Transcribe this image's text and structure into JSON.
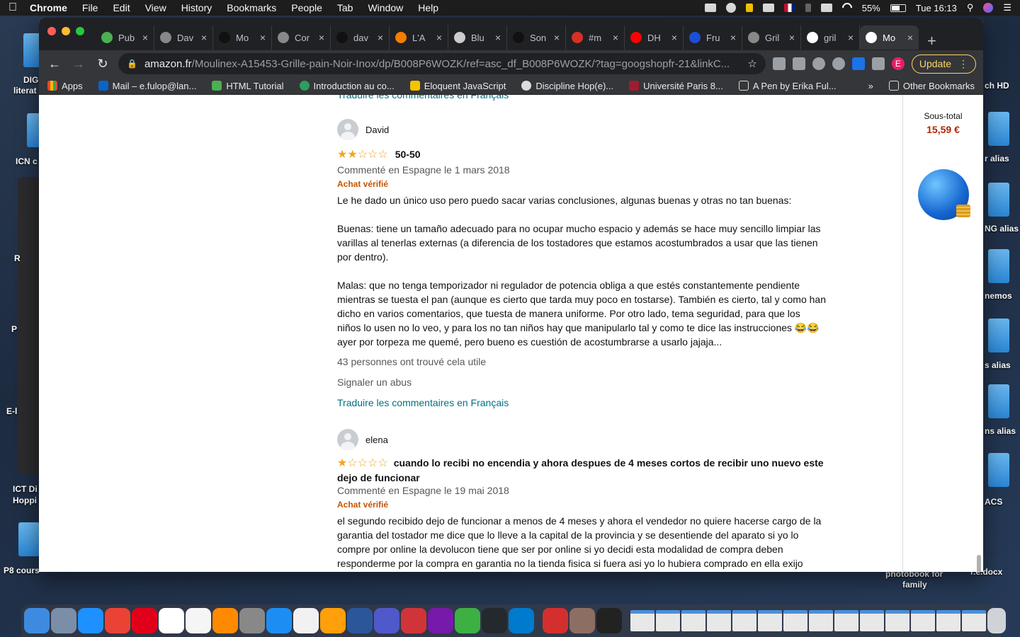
{
  "menubar": {
    "app": "Chrome",
    "items": [
      "File",
      "Edit",
      "View",
      "History",
      "Bookmarks",
      "People",
      "Tab",
      "Window",
      "Help"
    ],
    "battery": "55%",
    "clock": "Tue 16:13"
  },
  "desktop": {
    "left_labels": [
      "DIG",
      "literat",
      "ICN c",
      "R",
      "P",
      "E-l",
      "ICT Di",
      "Hoppi",
      "P8 cours"
    ],
    "right_labels": [
      "ch HD",
      "r alias",
      "NG alias",
      "nemos",
      "s alias",
      "ns alias",
      "ACS",
      "docx",
      "photobook for",
      "family",
      "r.e.docx"
    ]
  },
  "browser": {
    "tabs": [
      {
        "title": "Pub",
        "icon": "wifi-icon"
      },
      {
        "title": "Dav",
        "icon": "globe-icon"
      },
      {
        "title": "Mo",
        "icon": "github-icon"
      },
      {
        "title": "Cor",
        "icon": "globe-icon"
      },
      {
        "title": "dav",
        "icon": "github-icon"
      },
      {
        "title": "L'A",
        "icon": "blogger-icon"
      },
      {
        "title": "Blu",
        "icon": "wave-icon"
      },
      {
        "title": "Son",
        "icon": "github-icon"
      },
      {
        "title": "#m",
        "icon": "calendar-icon"
      },
      {
        "title": "DH",
        "icon": "youtube-icon"
      },
      {
        "title": "Fru",
        "icon": "carrefour-icon"
      },
      {
        "title": "Gril",
        "icon": "globe-icon"
      },
      {
        "title": "gril",
        "icon": "google-icon"
      },
      {
        "title": "Mo",
        "icon": "amazon-icon",
        "active": true
      }
    ],
    "url_host": "amazon.fr",
    "url_path": "/Moulinex-A15453-Grille-pain-Noir-Inox/dp/B008P6WOZK/ref=asc_df_B008P6WOZK/?tag=googshopfr-21&linkC...",
    "update_label": "Update",
    "profile_initial": "E",
    "bookmarks": [
      "Apps",
      "Mail – e.fulop@lan...",
      "HTML Tutorial",
      "Introduction au co...",
      "Eloquent JavaScript",
      "Discipline Hop(e)...",
      "Université Paris 8...",
      "A Pen by Erika Ful..."
    ],
    "bookmarks_overflow": "»",
    "other_bookmarks": "Other Bookmarks"
  },
  "page": {
    "top_translate": "Traduire les commentaires en Français",
    "reviews": [
      {
        "name": "David",
        "rating": 2,
        "title": "50-50",
        "meta": "Commenté en Espagne le 1 mars 2018",
        "verified": "Achat vérifié",
        "paragraphs": [
          "Le he dado un único uso pero puedo sacar varias conclusiones, algunas buenas y otras no tan buenas:",
          "Buenas: tiene un tamaño adecuado para no ocupar mucho espacio y además se hace muy sencillo limpiar las varillas al tenerlas externas (a diferencia de los tostadores que estamos acostumbrados a usar que las tienen por dentro).",
          "Malas: que no tenga temporizador ni regulador de potencia obliga a que estés constantemente pendiente mientras se tuesta el pan (aunque es cierto que tarda muy poco en tostarse). También es cierto, tal y como han dicho en varios comentarios, que tuesta de manera uniforme. Por otro lado, tema seguridad, para que los niños lo usen no lo veo, y para los no tan niños hay que manipularlo tal y como te dice las instrucciones 😂😂 ayer por torpeza me quemé, pero bueno es cuestión de acostumbrarse a usarlo jajaja..."
        ],
        "helpful": "43 personnes ont trouvé cela utile",
        "abuse": "Signaler un abus",
        "translate": "Traduire les commentaires en Français"
      },
      {
        "name": "elena",
        "rating": 1,
        "title": "cuando lo recibi no encendia y ahora despues de 4 meses cortos de recibir uno nuevo este dejo de funcionar",
        "meta": "Commenté en Espagne le 19 mai 2018",
        "verified": "Achat vérifié",
        "paragraphs": [
          "el segundo recibido dejo de funcionar a menos de 4 meses y ahora el vendedor no quiere hacerse cargo de la garantia del tostador me dice que lo lleve a la capital de la provincia y se desentiende del aparato si yo lo compre por online la devolucon tiene que ser por online si yo decidi esta modalidad de compra deben responderme por la compra en garantia no la tienda fisica si fuera asi yo lo hubiera comprado en ella exijo"
        ]
      }
    ],
    "cart": {
      "label": "Sous-total",
      "value": "15,59 €"
    }
  }
}
